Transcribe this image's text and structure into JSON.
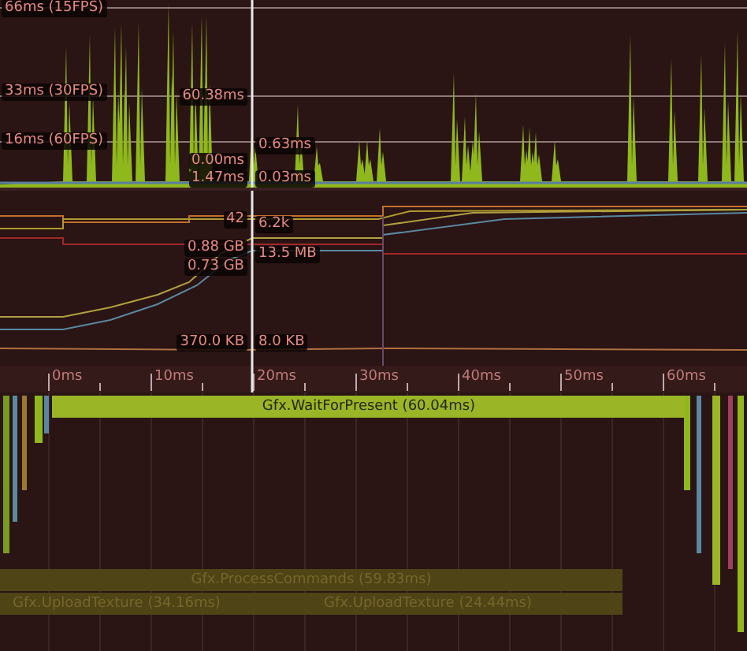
{
  "cpu_chart": {
    "threshold_labels": [
      "66ms (15FPS)",
      "33ms (30FPS)",
      "16ms (60FPS)"
    ],
    "cursor_labels": [
      "60.38ms",
      "0.00ms",
      "1.47ms",
      "0.63ms",
      "0.03ms"
    ]
  },
  "memory_chart": {
    "cursor_labels": [
      "42",
      "0.88 GB",
      "0.73 GB",
      "370.0 KB",
      "6.2k",
      "13.5 MB",
      "8.0 KB"
    ]
  },
  "timeline": {
    "ruler": [
      "0ms",
      "10ms",
      "20ms",
      "30ms",
      "40ms",
      "50ms",
      "60ms"
    ],
    "rows": [
      {
        "samples": [
          {
            "label": "Gfx.WaitForPresent (60.04ms)",
            "dimmed": false
          }
        ]
      },
      {
        "samples": [
          {
            "label": "Gfx.ProcessCommands (59.83ms)",
            "dimmed": true
          }
        ]
      },
      {
        "samples": [
          {
            "label": "Gfx.UploadTexture (34.16ms)",
            "dimmed": true
          },
          {
            "label": "Gfx.UploadTexture (24.44ms)",
            "dimmed": true
          }
        ]
      }
    ]
  }
}
